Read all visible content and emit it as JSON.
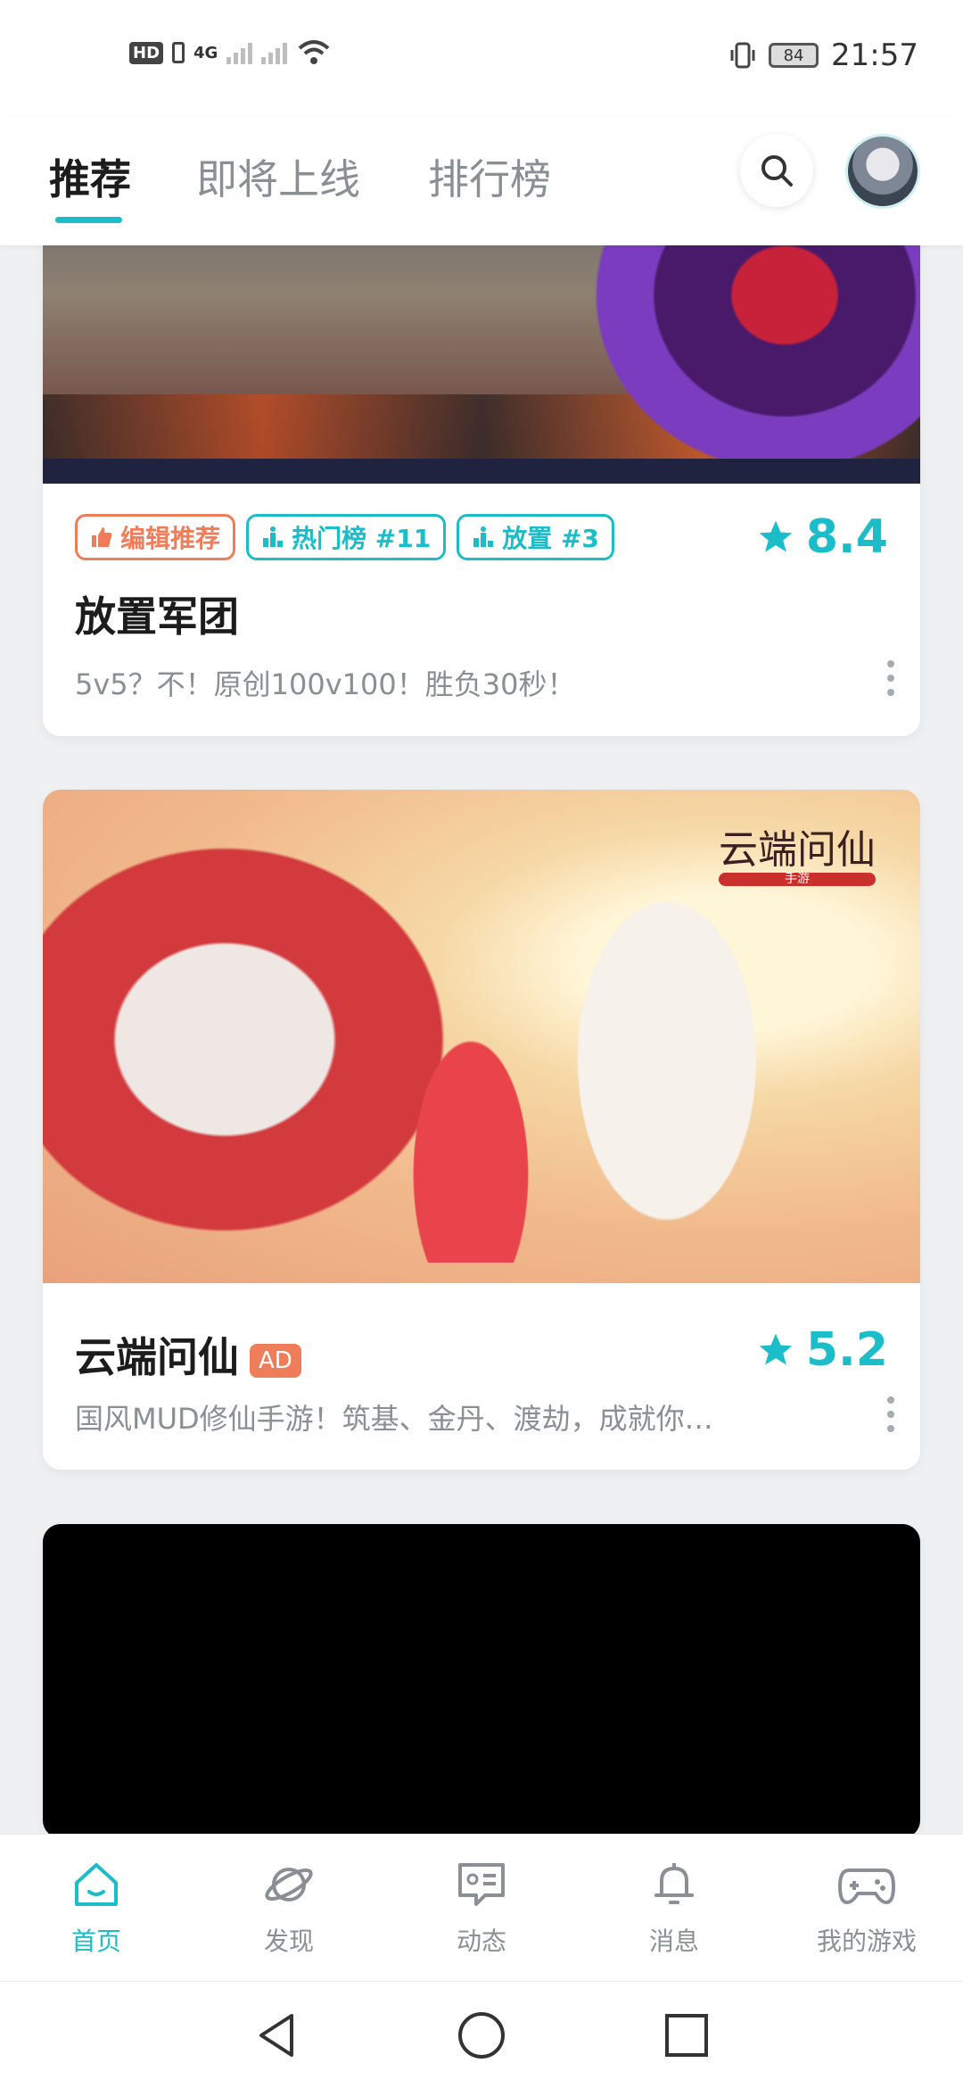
{
  "status_bar": {
    "hd_label": "HD",
    "network": "4G",
    "battery": "84",
    "time": "21:57"
  },
  "header": {
    "tabs": [
      {
        "label": "推荐",
        "active": true
      },
      {
        "label": "即将上线",
        "active": false
      },
      {
        "label": "排行榜",
        "active": false
      }
    ],
    "icons": {
      "search": "search-icon",
      "avatar": "user-avatar"
    }
  },
  "cards": [
    {
      "tags": [
        {
          "label": "编辑推荐",
          "icon": "thumbs-up-icon",
          "color": "#f07d5a"
        },
        {
          "label": "热门榜 #11",
          "icon": "podium-icon",
          "color": "#1bbdc8"
        },
        {
          "label": "放置 #3",
          "icon": "podium-icon",
          "color": "#1bbdc8"
        }
      ],
      "title": "放置军团",
      "rating": "8.4",
      "description": "5v5？不！原创100v100！胜负30秒！"
    },
    {
      "logo_text": "云端问仙",
      "logo_sub": "手游",
      "title": "云端问仙",
      "ad_label": "AD",
      "rating": "5.2",
      "description": "国风MUD修仙手游！筑基、金丹、渡劫，成就你…"
    }
  ],
  "bottom_nav": [
    {
      "label": "首页",
      "icon": "home-icon",
      "active": true
    },
    {
      "label": "发现",
      "icon": "planet-icon",
      "active": false
    },
    {
      "label": "动态",
      "icon": "chat-card-icon",
      "active": false
    },
    {
      "label": "消息",
      "icon": "bell-icon",
      "active": false
    },
    {
      "label": "我的游戏",
      "icon": "gamepad-icon",
      "active": false
    }
  ],
  "colors": {
    "accent": "#1bbdc8",
    "orange": "#f07d5a",
    "text_primary": "#1c1c1c",
    "text_secondary": "#8a8f95"
  }
}
